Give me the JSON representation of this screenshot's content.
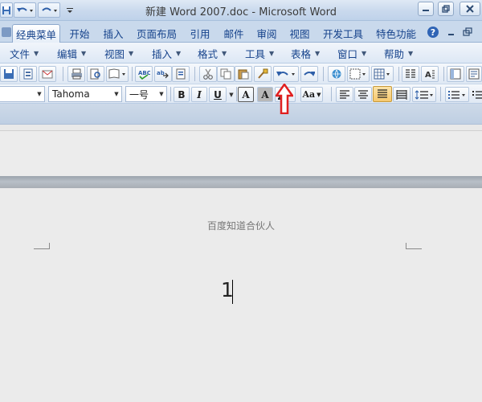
{
  "window": {
    "title": "新建 Word 2007.doc - Microsoft Word",
    "controls": [
      "minimize",
      "restore",
      "close"
    ]
  },
  "quick_access": {
    "items": [
      "save-icon",
      "undo-icon",
      "redo-icon",
      "customize-qat-icon"
    ]
  },
  "ribbon_tabs": [
    {
      "label": "经典菜单",
      "active": true
    },
    {
      "label": "开始"
    },
    {
      "label": "插入"
    },
    {
      "label": "页面布局"
    },
    {
      "label": "引用"
    },
    {
      "label": "邮件"
    },
    {
      "label": "审阅"
    },
    {
      "label": "视图"
    },
    {
      "label": "开发工具"
    },
    {
      "label": "特色功能"
    }
  ],
  "ribbon_right": [
    "help-icon",
    "minimize-ribbon-icon",
    "restore-doc-icon"
  ],
  "menus": [
    {
      "label": "文件"
    },
    {
      "label": "编辑"
    },
    {
      "label": "视图"
    },
    {
      "label": "插入"
    },
    {
      "label": "格式"
    },
    {
      "label": "工具"
    },
    {
      "label": "表格"
    },
    {
      "label": "窗口"
    },
    {
      "label": "帮助"
    }
  ],
  "format_toolbar": {
    "font_name": "Tahoma",
    "font_size": "一号",
    "bold": "B",
    "italic": "I",
    "underline": "U",
    "font_color_a": "A",
    "char_shading_a": "A",
    "change_case": "Aa"
  },
  "annotation": {
    "shape": "red-up-arrow",
    "color": "#e02020",
    "points_to": "undo-button"
  },
  "document": {
    "header_text": "百度知道合伙人",
    "body_text": "1"
  },
  "colors": {
    "titlebar": "#c9d9ed",
    "ribbon_text": "#15428b",
    "page_background": "#ebebeb",
    "highlighted_align": "#f6c86e"
  }
}
